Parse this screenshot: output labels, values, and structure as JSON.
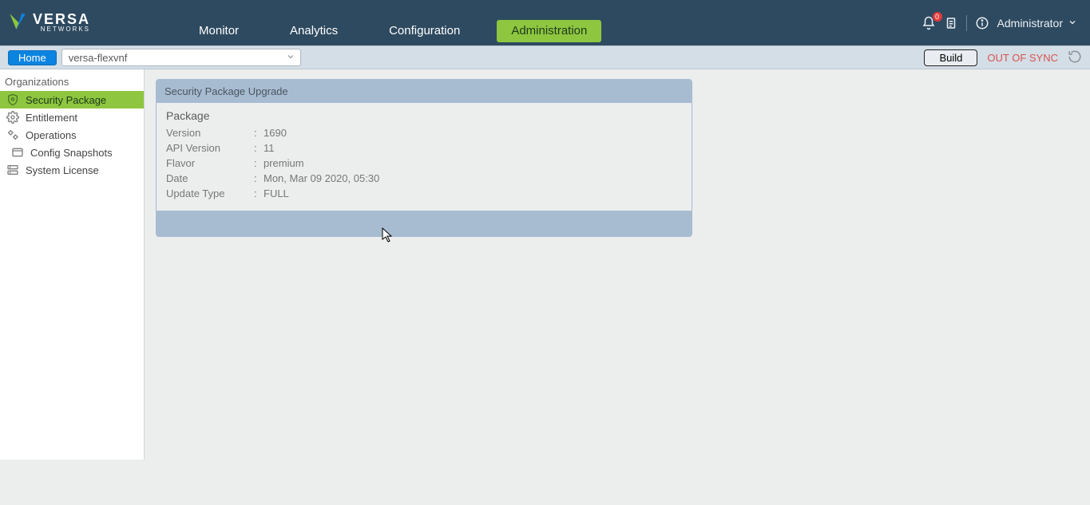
{
  "brand": {
    "title": "VERSA",
    "subtitle": "NETWORKS"
  },
  "topnav": {
    "items": [
      {
        "label": "Monitor"
      },
      {
        "label": "Analytics"
      },
      {
        "label": "Configuration"
      },
      {
        "label": "Administration"
      }
    ],
    "active_index": 3
  },
  "header_tools": {
    "notification_count": "0",
    "user_label": "Administrator"
  },
  "subbar": {
    "home_label": "Home",
    "selected_device": "versa-flexvnf",
    "build_label": "Build",
    "sync_status": "OUT OF SYNC"
  },
  "sidebar": {
    "heading": "Organizations",
    "items": [
      {
        "icon": "shield-search-icon",
        "label": "Security Package",
        "indent": 1
      },
      {
        "icon": "gear-icon",
        "label": "Entitlement",
        "indent": 1
      },
      {
        "icon": "gears-icon",
        "label": "Operations",
        "indent": 1
      },
      {
        "icon": "window-icon",
        "label": "Config Snapshots",
        "indent": 2
      },
      {
        "icon": "server-icon",
        "label": "System License",
        "indent": 1
      }
    ],
    "active_index": 0
  },
  "card": {
    "title": "Security Package Upgrade",
    "section": "Package",
    "rows": [
      {
        "key": "Version",
        "value": "1690"
      },
      {
        "key": "API Version",
        "value": "11"
      },
      {
        "key": "Flavor",
        "value": "premium"
      },
      {
        "key": "Date",
        "value": "Mon, Mar 09 2020, 05:30"
      },
      {
        "key": "Update Type",
        "value": "FULL"
      }
    ]
  }
}
